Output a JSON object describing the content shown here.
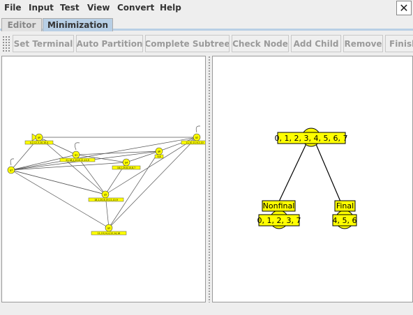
{
  "menu": {
    "items": [
      "File",
      "Input",
      "Test",
      "View",
      "Convert",
      "Help"
    ],
    "close_glyph": "✕"
  },
  "tabs": [
    {
      "label": "Editor",
      "active": false
    },
    {
      "label": "Minimization",
      "active": true
    }
  ],
  "toolbar": {
    "buttons": [
      "Set Terminal",
      "Auto Partition",
      "Complete Subtree",
      "Check Node",
      "Add Child",
      "Remove",
      "Finish"
    ]
  },
  "automaton": {
    "states": [
      {
        "id": "q0",
        "label": "0,2,12,3,10,10,4"
      },
      {
        "id": "q1",
        "label": "21,18,1,20,8,11,10,9"
      },
      {
        "id": "q2",
        "label": "11,10,11,9,2,10"
      },
      {
        "id": "q3",
        "label": "11,13,14,4,12,14,16"
      },
      {
        "id": "q4",
        "label": "18,1,20,8,10,8,7"
      },
      {
        "id": "q5",
        "label": "18,1,20,8,19,11,10,9"
      },
      {
        "id": "q6",
        "label": "9,8"
      },
      {
        "id": "q7",
        "label": ""
      }
    ]
  },
  "tree": {
    "root": "0, 1, 2, 3, 4, 5, 6, 7",
    "children": [
      {
        "title": "Nonfinal",
        "set": "0, 1, 2, 3, 7"
      },
      {
        "title": "Final",
        "set": "4, 5, 6"
      }
    ]
  },
  "colors": {
    "node_fill": "#ffff00",
    "tab_active": "#b8cfe5"
  }
}
